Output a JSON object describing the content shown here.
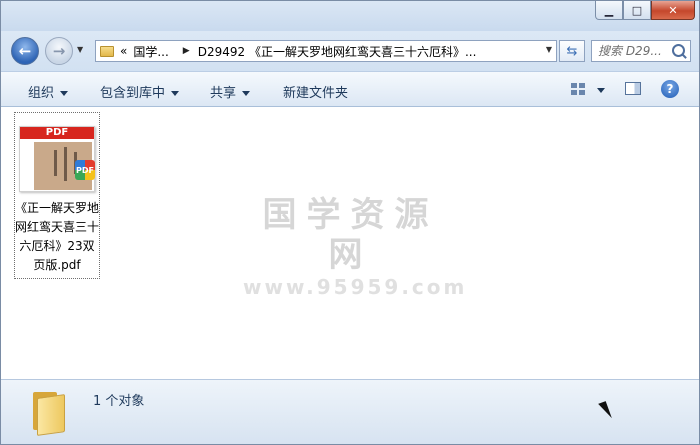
{
  "window": {
    "buttons": {
      "minimize": "▁",
      "maximize": "□",
      "close": "✕"
    }
  },
  "address": {
    "overflow": "«",
    "crumbs": [
      "国学...",
      "D29492 《正一解天罗地网红鸾天喜三十六厄科》..."
    ],
    "search_placeholder": "搜索 D29..."
  },
  "toolbar": {
    "organize": "组织",
    "include_library": "包含到库中",
    "share": "共享",
    "new_folder": "新建文件夹",
    "help": "?"
  },
  "file": {
    "badge": "PDF",
    "name": "《正一解天罗地网红鸾天喜三十六厄科》23双页版.pdf"
  },
  "watermark": {
    "title": "国学资源网",
    "url": "www.95959.com"
  },
  "status": {
    "count": "1 个对象"
  },
  "colors": {
    "accent": "#1e395b",
    "pdf_red": "#d7261e"
  },
  "icons": [
    "back-arrow-icon",
    "forward-arrow-icon",
    "folder-icon",
    "refresh-icon",
    "search-icon",
    "view-options-icon",
    "preview-pane-icon",
    "help-icon",
    "pdf-file-icon"
  ]
}
